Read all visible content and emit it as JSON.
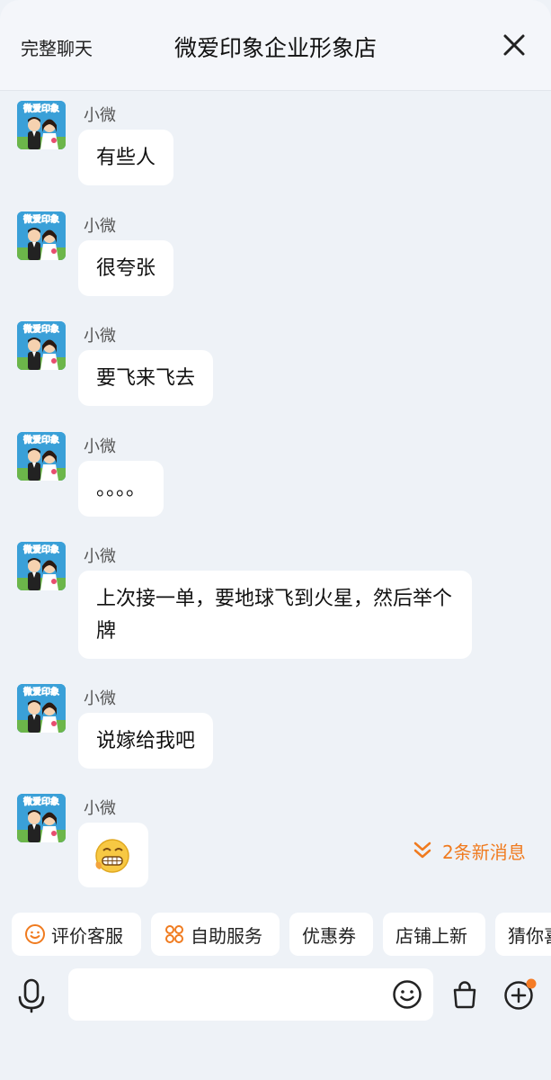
{
  "header": {
    "full_chat_label": "完整聊天",
    "title": "微爱印象企业形象店"
  },
  "avatar": {
    "logo_text": "微爱印象"
  },
  "messages": [
    {
      "sender": "小微",
      "text": "有些人"
    },
    {
      "sender": "小微",
      "text": "很夸张"
    },
    {
      "sender": "小微",
      "text": "要飞来飞去"
    },
    {
      "sender": "小微",
      "text": "。。。。"
    },
    {
      "sender": "小微",
      "text": "上次接一单，要地球飞到火星，然后举个牌"
    },
    {
      "sender": "小微",
      "text": "说嫁给我吧"
    },
    {
      "sender": "小微",
      "emoji": "grimacing-face-emoji"
    }
  ],
  "new_messages": {
    "label": "2条新消息",
    "color": "#f07b1f"
  },
  "quick_actions": [
    {
      "label": "评价客服",
      "icon": "smile-icon"
    },
    {
      "label": "自助服务",
      "icon": "grid-icon"
    },
    {
      "label": "优惠券"
    },
    {
      "label": "店铺上新"
    },
    {
      "label": "猜你喜"
    }
  ],
  "input": {
    "placeholder": "",
    "icons": [
      "voice-icon",
      "emoji-icon",
      "shopping-bag-icon",
      "plus-icon"
    ],
    "badge_color": "#f57c26"
  }
}
